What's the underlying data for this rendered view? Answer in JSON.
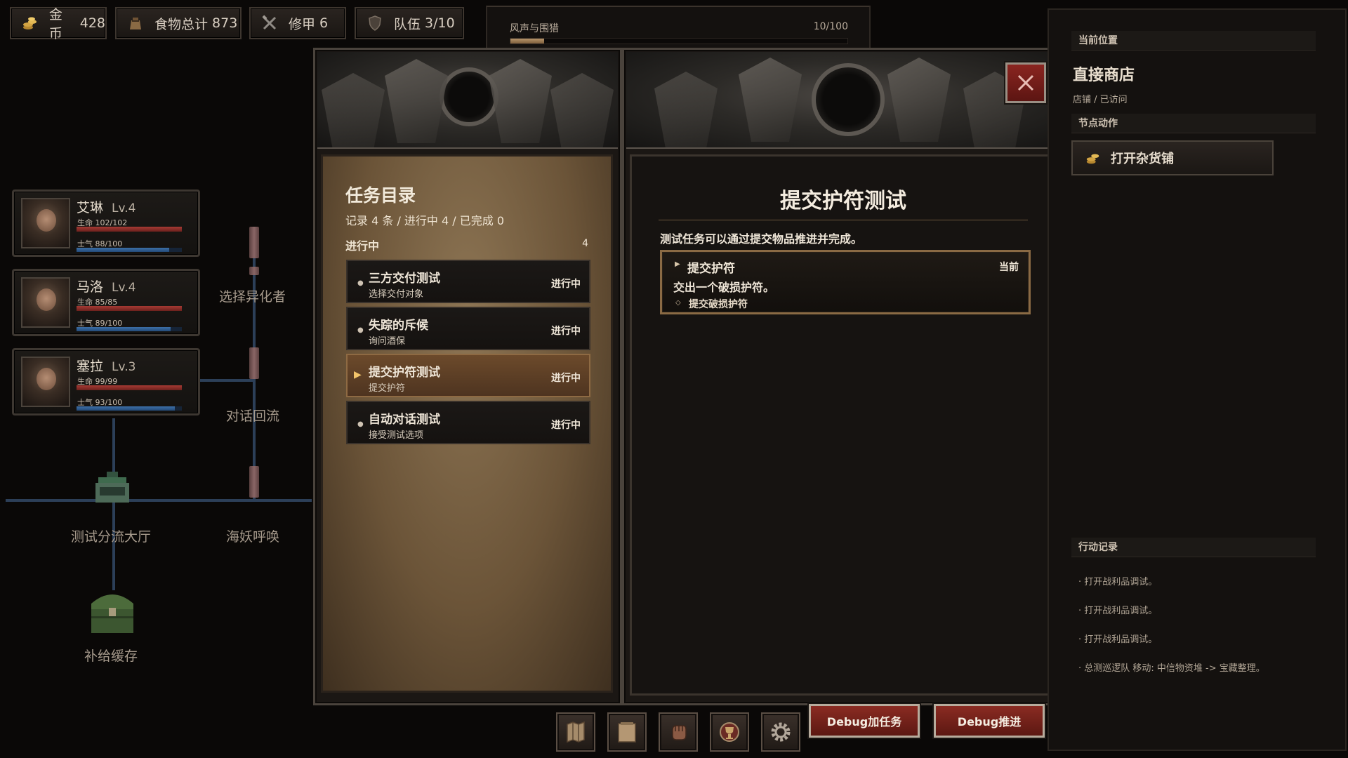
{
  "resources": [
    {
      "label": "金币",
      "value": "428",
      "icon": "coin-pile-icon"
    },
    {
      "label": "食物总计",
      "value": "873",
      "icon": "food-sack-icon"
    },
    {
      "label": "修甲",
      "value": "6",
      "icon": "crossed-tools-icon"
    },
    {
      "label": "队伍",
      "value": "3/10",
      "icon": "shield-icon"
    }
  ],
  "wind": {
    "title": "风声与围猎",
    "value": "10/100",
    "progress": 0.1
  },
  "party": [
    {
      "name": "艾琳",
      "level": "Lv.4",
      "hp": "生命 102/102",
      "hp_ratio": 1.0,
      "morale": "士气 88/100",
      "morale_ratio": 0.88
    },
    {
      "name": "马洛",
      "level": "Lv.4",
      "hp": "生命 85/85",
      "hp_ratio": 1.0,
      "morale": "士气 89/100",
      "morale_ratio": 0.89
    },
    {
      "name": "塞拉",
      "level": "Lv.3",
      "hp": "生命 99/99",
      "hp_ratio": 1.0,
      "morale": "士气 93/100",
      "morale_ratio": 0.93
    }
  ],
  "map": {
    "nodes": [
      "选择异化者",
      "对话回流",
      "测试分流大厅",
      "海妖呼唤",
      "补给缓存"
    ]
  },
  "questlog": {
    "title": "任务目录",
    "summary": "记录 4 条 / 进行中 4 / 已完成 0",
    "group": "进行中",
    "group_count": "4",
    "quests": [
      {
        "name": "三方交付测试",
        "sub": "选择交付对象",
        "status": "进行中",
        "selected": false
      },
      {
        "name": "失踪的斥候",
        "sub": "询问酒保",
        "status": "进行中",
        "selected": false
      },
      {
        "name": "提交护符测试",
        "sub": "提交护符",
        "status": "进行中",
        "selected": true
      },
      {
        "name": "自动对话测试",
        "sub": "接受测试选项",
        "status": "进行中",
        "selected": false
      }
    ]
  },
  "detail": {
    "title": "提交护符测试",
    "desc": "测试任务可以通过提交物品推进并完成。",
    "objective": {
      "name": "提交护符",
      "current": "当前",
      "desc": "交出一个破损护符。",
      "step": "提交破损护符"
    }
  },
  "right_panel": {
    "location_header": "当前位置",
    "location": "直接商店",
    "location_sub": "店铺 / 已访问",
    "actions_header": "节点动作",
    "shop_button": "打开杂货铺",
    "log_header": "行动记录",
    "logs": [
      "· 打开战利品调试。",
      "· 打开战利品调试。",
      "· 打开战利品调试。",
      "· 总测巡逻队 移动: 中信物资堆 -> 宝藏整理。"
    ]
  },
  "toolbar": {
    "icons": [
      "map-icon",
      "journal-icon",
      "fist-icon",
      "trophy-icon",
      "gear-icon"
    ],
    "debug_add": "Debug加任务",
    "debug_advance": "Debug推进"
  },
  "colors": {
    "accent": "#8a6a44",
    "danger": "#8a2520",
    "hp": "#a63a34",
    "morale": "#3d6fa7"
  }
}
